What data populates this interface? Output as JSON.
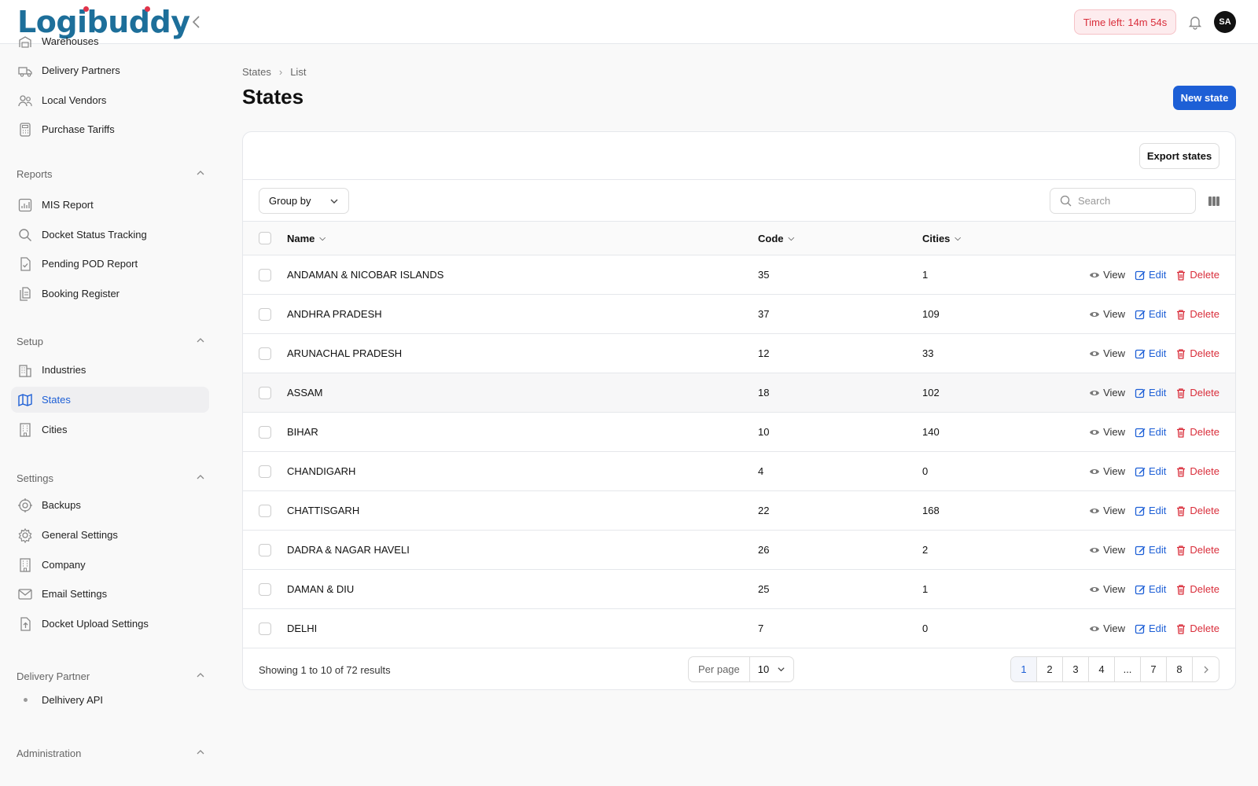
{
  "app": {
    "logo_text": "Logibuddy",
    "timer": "Time left: 14m 54s",
    "avatar": "SA"
  },
  "sidebar": {
    "items_top": [
      {
        "label": "Warehouses",
        "icon": "warehouse-icon"
      },
      {
        "label": "Delivery Partners",
        "icon": "truck-icon"
      },
      {
        "label": "Local Vendors",
        "icon": "users-icon"
      },
      {
        "label": "Purchase Tariffs",
        "icon": "calculator-icon"
      }
    ],
    "groups": {
      "reports": "Reports",
      "setup": "Setup",
      "settings": "Settings",
      "delivery_partner": "Delivery Partner",
      "administration": "Administration"
    },
    "reports": [
      {
        "label": "MIS Report",
        "icon": "chart-icon"
      },
      {
        "label": "Docket Status Tracking",
        "icon": "search-icon"
      },
      {
        "label": "Pending POD Report",
        "icon": "document-check-icon"
      },
      {
        "label": "Booking Register",
        "icon": "documents-icon"
      }
    ],
    "setup": [
      {
        "label": "Industries",
        "icon": "building-icon"
      },
      {
        "label": "States",
        "icon": "map-icon",
        "active": true
      },
      {
        "label": "Cities",
        "icon": "office-icon"
      }
    ],
    "settings": [
      {
        "label": "Backups",
        "icon": "gear-badge-icon"
      },
      {
        "label": "General Settings",
        "icon": "gear-icon"
      },
      {
        "label": "Company",
        "icon": "office-icon"
      },
      {
        "label": "Email Settings",
        "icon": "envelope-icon"
      },
      {
        "label": "Docket Upload Settings",
        "icon": "upload-doc-icon"
      }
    ],
    "delivery_partner": [
      {
        "label": "Delhivery API"
      }
    ]
  },
  "main": {
    "breadcrumb": [
      "States",
      "List"
    ],
    "title": "States",
    "new_button": "New state",
    "export_button": "Export states",
    "group_by": "Group by",
    "search_placeholder": "Search",
    "columns": {
      "name": "Name",
      "code": "Code",
      "cities": "Cities"
    },
    "actions": {
      "view": "View",
      "edit": "Edit",
      "delete": "Delete"
    },
    "rows": [
      {
        "name": "ANDAMAN & NICOBAR ISLANDS",
        "code": "35",
        "cities": "1"
      },
      {
        "name": "ANDHRA PRADESH",
        "code": "37",
        "cities": "109"
      },
      {
        "name": "ARUNACHAL PRADESH",
        "code": "12",
        "cities": "33"
      },
      {
        "name": "ASSAM",
        "code": "18",
        "cities": "102"
      },
      {
        "name": "BIHAR",
        "code": "10",
        "cities": "140"
      },
      {
        "name": "CHANDIGARH",
        "code": "4",
        "cities": "0"
      },
      {
        "name": "CHATTISGARH",
        "code": "22",
        "cities": "168"
      },
      {
        "name": "DADRA & NAGAR HAVELI",
        "code": "26",
        "cities": "2"
      },
      {
        "name": "DAMAN & DIU",
        "code": "25",
        "cities": "1"
      },
      {
        "name": "DELHI",
        "code": "7",
        "cities": "0"
      }
    ],
    "footer": {
      "results": "Showing 1 to 10 of 72 results",
      "per_page_label": "Per page",
      "per_page_value": "10",
      "pages": [
        "1",
        "2",
        "3",
        "4",
        "...",
        "7",
        "8"
      ]
    }
  },
  "colors": {
    "accent": "#1d5fd6",
    "danger": "#d92d3a",
    "logo": "#1d6f9a"
  }
}
